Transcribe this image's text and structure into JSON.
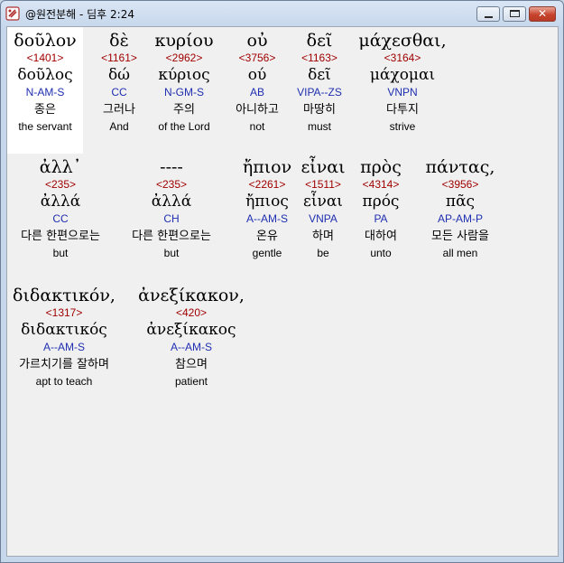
{
  "window": {
    "title": "@원전분해 - 딤후 2:24",
    "minimize_icon": "minimize-icon",
    "maximize_icon": "maximize-icon",
    "close_icon": "close-icon",
    "close_glyph": "✕"
  },
  "rows": [
    [
      {
        "greek": "δοῦλον",
        "strong": "<1401>",
        "lemma": "δοῦλος",
        "parse": "N-AM-S",
        "korean": "종은",
        "english": "the servant",
        "highlighted": true
      },
      {
        "greek": "δὲ",
        "strong": "<1161>",
        "lemma": "δώ",
        "parse": "CC",
        "korean": "그러나",
        "english": "And"
      },
      {
        "greek": "κυρίου",
        "strong": "<2962>",
        "lemma": "κύριος",
        "parse": "N-GM-S",
        "korean": "주의",
        "english": "of the Lord"
      },
      {
        "greek": "οὐ",
        "strong": "<3756>",
        "lemma": "ού",
        "parse": "AB",
        "korean": "아니하고",
        "english": "not"
      },
      {
        "greek": "δεῖ",
        "strong": "<1163>",
        "lemma": "δεῖ",
        "parse": "VIPA--ZS",
        "korean": "마땅히",
        "english": "must"
      },
      {
        "greek": "μάχεσθαι,",
        "strong": "<3164>",
        "lemma": "μάχομαι",
        "parse": "VNPN",
        "korean": "다투지",
        "english": "strive"
      }
    ],
    [
      {
        "greek": "ἀλλ᾽",
        "strong": "<235>",
        "lemma": "ἀλλά",
        "parse": "CC",
        "korean": "다른 한편으로는",
        "english": "but"
      },
      {
        "greek": "----",
        "strong": "<235>",
        "lemma": "ἀλλά",
        "parse": "CH",
        "korean": "다른 한편으로는",
        "english": "but"
      },
      {
        "greek": "ἤπιον",
        "strong": "<2261>",
        "lemma": "ἤπιος",
        "parse": "A--AM-S",
        "korean": "온유",
        "english": "gentle"
      },
      {
        "greek": "εἶναι",
        "strong": "<1511>",
        "lemma": "εἶναι",
        "parse": "VNPA",
        "korean": "하며",
        "english": "be"
      },
      {
        "greek": "πρὸς",
        "strong": "<4314>",
        "lemma": "πρός",
        "parse": "PA",
        "korean": "대하여",
        "english": "unto"
      },
      {
        "greek": "πάντας,",
        "strong": "<3956>",
        "lemma": "πᾶς",
        "parse": "AP-AM-P",
        "korean": "모든 사람을",
        "english": "all men"
      }
    ],
    [
      {
        "greek": "διδακτικόν,",
        "strong": "<1317>",
        "lemma": "διδακτικός",
        "parse": "A--AM-S",
        "korean": "가르치기를 잘하며",
        "english": "apt to teach"
      },
      {
        "greek": "ἀνεξίκακον,",
        "strong": "<420>",
        "lemma": "ἀνεξίκακος",
        "parse": "A--AM-S",
        "korean": "참으며",
        "english": "patient"
      }
    ]
  ]
}
